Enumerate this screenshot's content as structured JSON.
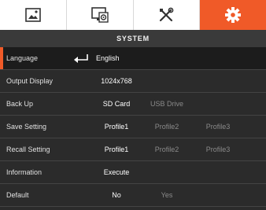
{
  "tabs": [
    {
      "icon": "picture-icon",
      "active": false
    },
    {
      "icon": "display-settings-icon",
      "active": false
    },
    {
      "icon": "tools-icon",
      "active": false
    },
    {
      "icon": "gear-icon",
      "active": true
    }
  ],
  "header": {
    "title": "SYSTEM"
  },
  "accent_color": "#f05a28",
  "rows": {
    "language": {
      "label": "Language",
      "value": "English",
      "icon": "enter-icon"
    },
    "output_display": {
      "label": "Output Display",
      "value": "1024x768"
    },
    "back_up": {
      "label": "Back Up",
      "options": [
        "SD Card",
        "USB Drive"
      ]
    },
    "save_setting": {
      "label": "Save Setting",
      "options": [
        "Profile1",
        "Profile2",
        "Profile3"
      ]
    },
    "recall_setting": {
      "label": "Recall Setting",
      "options": [
        "Profile1",
        "Profile2",
        "Profile3"
      ]
    },
    "information": {
      "label": "Information",
      "value": "Execute"
    },
    "default": {
      "label": "Default",
      "options": [
        "No",
        "Yes"
      ]
    }
  }
}
